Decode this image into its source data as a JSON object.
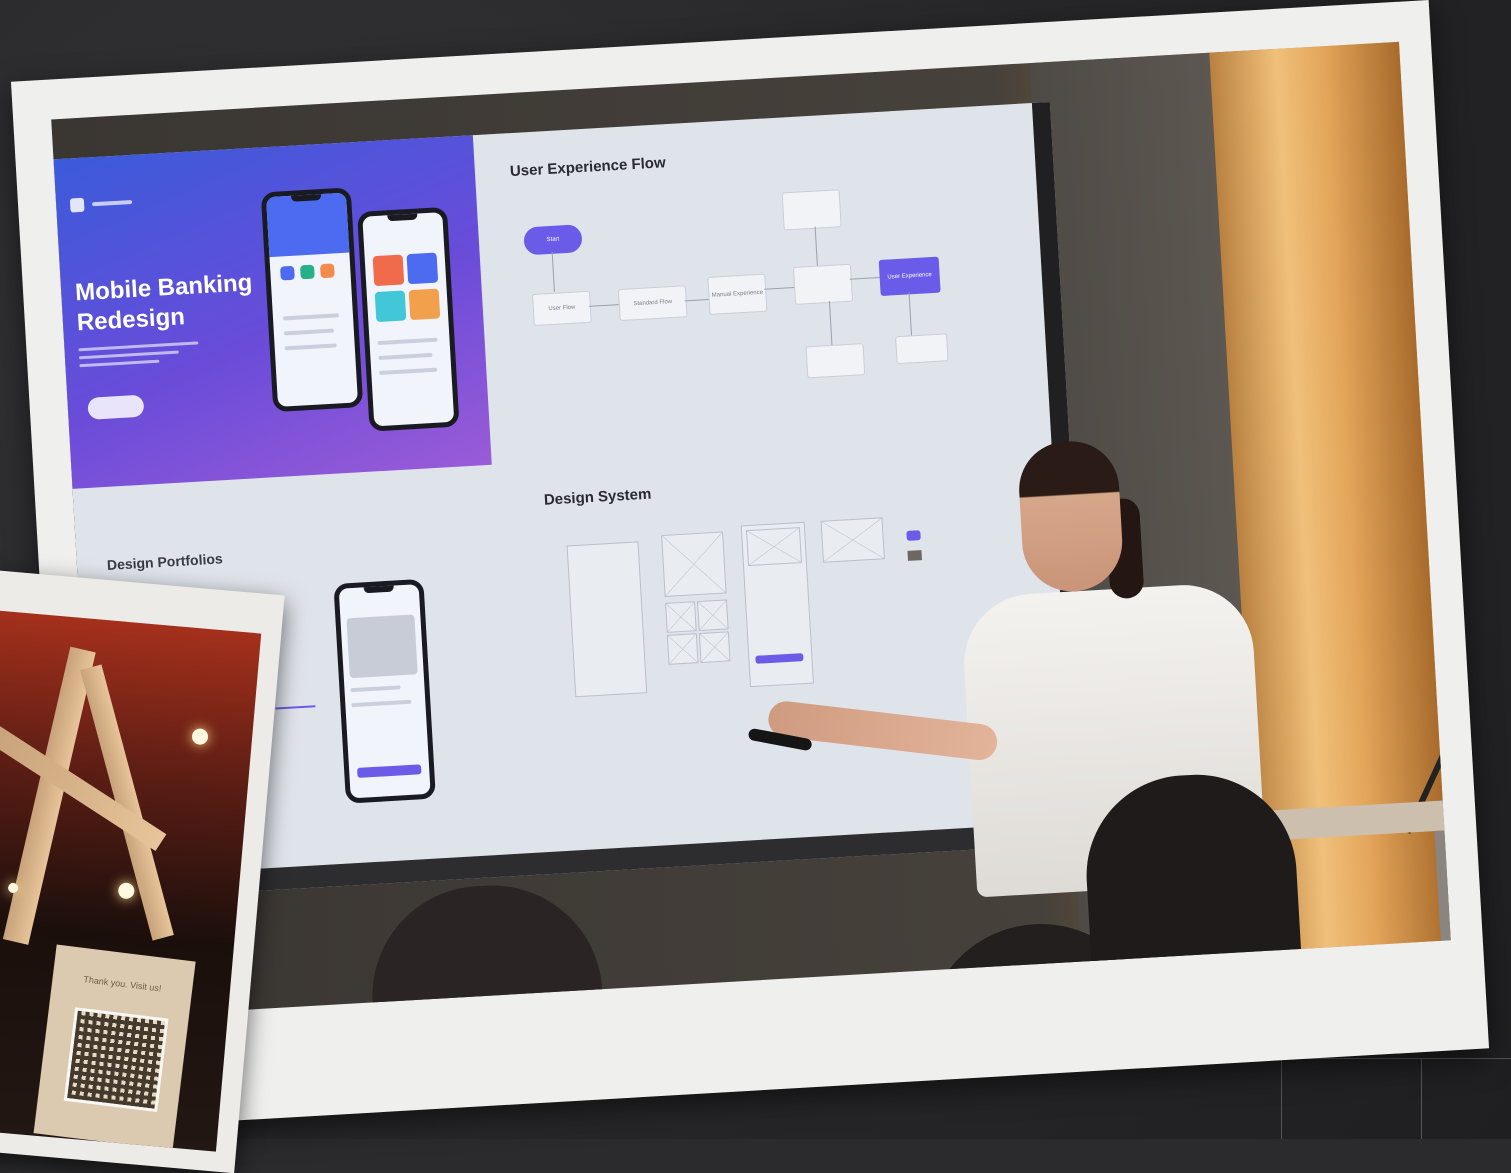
{
  "slide": {
    "hero_title_line1": "Mobile Banking",
    "hero_title_line2": "Redesign",
    "flow_title": "User Experience Flow",
    "design_system_title": "Design System",
    "portfolio_title": "Design Portfolios",
    "flow_nodes": {
      "start": "Start",
      "user_flow": "User Flow",
      "standard_flow": "Standard Flow",
      "manual_experience": "Manual Experience",
      "user_experience": "User Experience"
    }
  },
  "small_photo": {
    "card_text": "Thank you. Visit us!"
  },
  "colors": {
    "accent_purple": "#6a5ce8",
    "hero_blue": "#3b5bdb",
    "frame": "#efefed",
    "background": "#2b2b2d"
  }
}
